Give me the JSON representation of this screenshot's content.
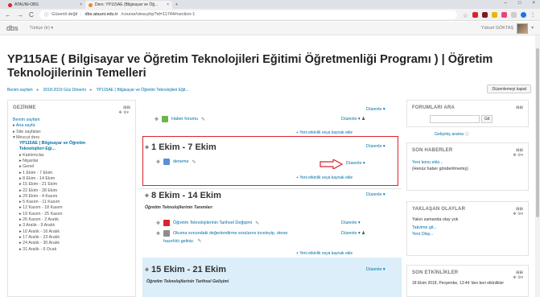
{
  "browser": {
    "tabs": [
      {
        "label": "ATAUNI-OBS",
        "active": false
      },
      {
        "label": "Ders: YP115AE (Bilgisayar ve Öğ...",
        "active": true
      }
    ],
    "new_tab": "+",
    "window_controls": [
      "–",
      "□",
      "×"
    ],
    "back": "←",
    "forward": "→",
    "reload": "C",
    "security": "Güvenli değil",
    "url_host": "dbs.atauni.edu.tr",
    "url_path": "/course/view.php?id=11744#section-1"
  },
  "navbar": {
    "brand": "dbs",
    "language": "Türkçe (tr) ▾",
    "user_name": "Yüksel GÖKTAŞ"
  },
  "page": {
    "title": "YP115AE ( Bilgisayar ve Öğretim Teknolojileri Eğitimi Öğretmenliği Programı ) | Öğretim Teknolojilerinin Temelleri",
    "breadcrumb": [
      "Benim sayfam",
      "2018-2019 Güz Dönemi",
      "YP115AE ( Bilgisayar ve Öğretim Teknolojileri Eğit..."
    ],
    "edit_button": "Düzenlemeyi kapat"
  },
  "left_nav": {
    "header": "GEZİNME",
    "items": [
      "Benim sayfam",
      "▸ Ana sayfa",
      "▸ Site sayfaları",
      "▾ Mevcut ders",
      "YP115AE ( Bilgisayar ve Öğretim",
      "Teknolojileri Eği...",
      "▸ Katılımcılar",
      "▸ Nişanlar",
      "▸ Genel",
      "▸ 1 Ekim - 7 Ekim",
      "▸ 8 Ekim - 14 Ekim",
      "▸ 15 Ekim - 21 Ekim",
      "▸ 22 Ekim - 28 Ekim",
      "▸ 29 Ekim - 4 Kasım",
      "▸ 5 Kasım - 11 Kasım",
      "▸ 12 Kasım - 18 Kasım",
      "▸ 19 Kasım - 25 Kasım",
      "▸ 26 Kasım - 2 Aralık",
      "▸ 3 Aralık - 9 Aralık",
      "▸ 10 Aralık - 16 Aralık",
      "▸ 17 Aralık - 23 Aralık",
      "▸ 24 Aralık - 30 Aralık",
      "▸ 31 Aralık - 6 Ocak"
    ]
  },
  "center": {
    "edit_label": "Düzenle ▾",
    "add_activity": "Yeni etkinlik veya kaynak ekle",
    "forum": "Haber forumu",
    "section1": {
      "title": "1 Ekim - 7 Ekim",
      "activity": "deneme"
    },
    "section2": {
      "title": "8 Ekim - 14 Ekim",
      "desc": "Öğretim Teknolojilerinin Tanımları",
      "act1": "Öğretim Teknolojilerinin Tarihsel Değişimi",
      "act2a": "Okuma sonundaki değerlendirme sorularını inceleyip, derse",
      "act2b": "hazırlıklı geliniz."
    },
    "section3": {
      "title": "15 Ekim - 21 Ekim",
      "desc": "Öğretim Teknolojilerinin Tarihsel Gelişimi"
    }
  },
  "right": {
    "forums": {
      "header": "FORUMLARI ARA",
      "go": "Git",
      "advanced": "Gelişmiş arama ⓘ"
    },
    "news": {
      "header": "SON HABERLER",
      "add": "Yeni konu ekle...",
      "none": "(Henüz haber gönderilmemiş)"
    },
    "upcoming": {
      "header": "YAKLAŞAN OLAYLAR",
      "none": "Yakın zamanda olay yok",
      "calendar": "Takvime git...",
      "new": "Yeni Olay..."
    },
    "activities": {
      "header": "SON ETKİNLİKLER",
      "since": "18 Ekim 2018, Perşembe, 13:44 'den beri etkinlikler"
    }
  },
  "colors": {
    "link": "#0070a8",
    "highlight": "#d9232d",
    "current_section": "#dbeef9"
  }
}
